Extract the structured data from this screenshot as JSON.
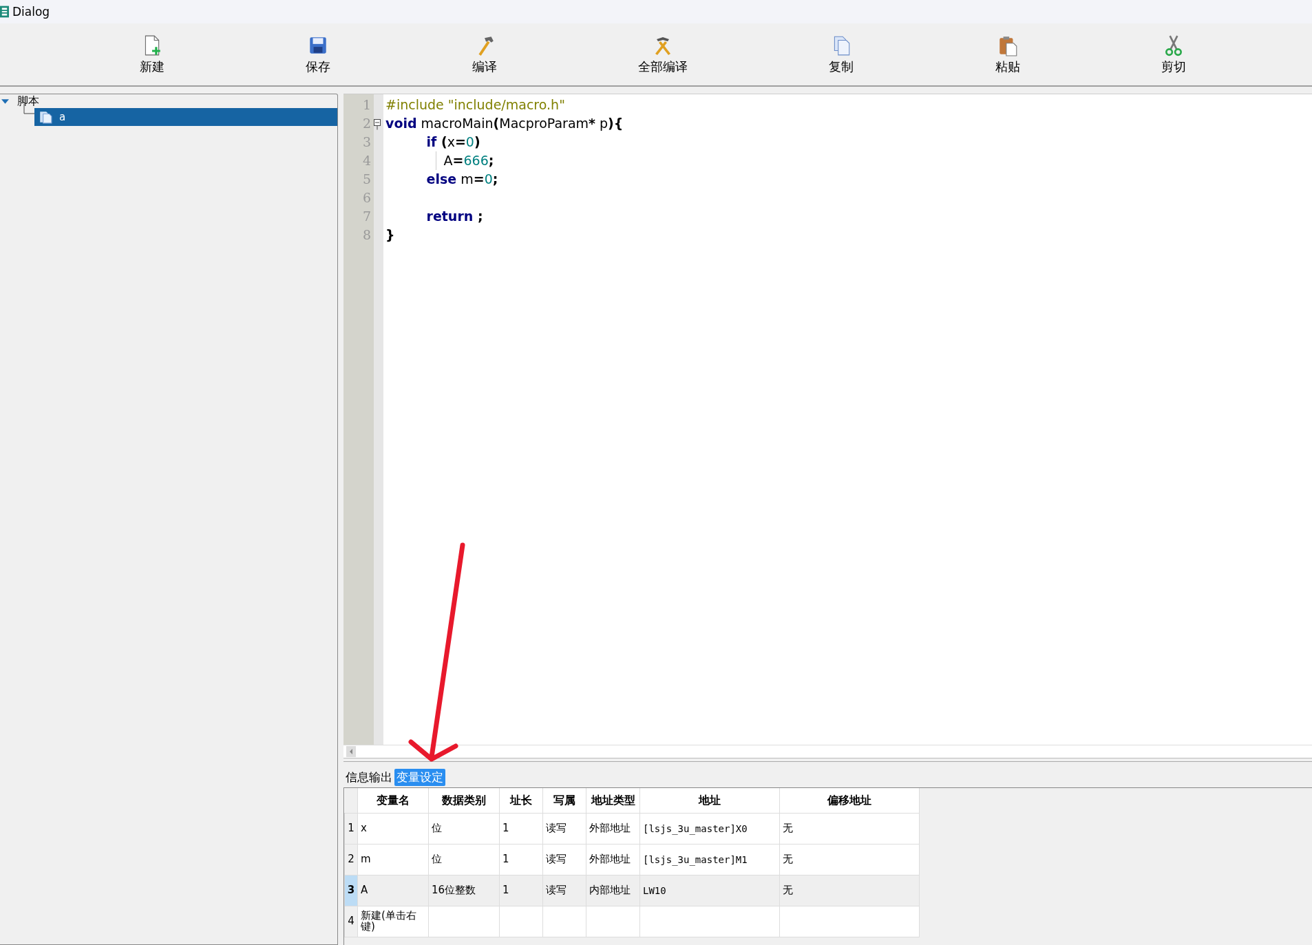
{
  "window": {
    "title": "Dialog"
  },
  "toolbar": [
    {
      "label": "新建"
    },
    {
      "label": "保存"
    },
    {
      "label": "编译"
    },
    {
      "label": "全部编译"
    },
    {
      "label": "复制"
    },
    {
      "label": "粘贴"
    },
    {
      "label": "剪切"
    }
  ],
  "tree": [
    {
      "label": "脚本",
      "expanded": true,
      "children": [
        {
          "label": "a",
          "selected": true
        }
      ]
    }
  ],
  "editor": {
    "lines": [
      {
        "number": "1",
        "tokens": [
          {
            "text": "#include \"include/macro.h\"",
            "kind": "preproc"
          }
        ]
      },
      {
        "number": "2",
        "fold": true,
        "tokens": [
          {
            "text": "void",
            "kind": "keyword"
          },
          {
            "text": " macroMain",
            "kind": "plain"
          },
          {
            "text": "(",
            "kind": "op"
          },
          {
            "text": "MacproParam",
            "kind": "plain"
          },
          {
            "text": "*",
            "kind": "op"
          },
          {
            "text": " p",
            "kind": "plain"
          },
          {
            "text": "){",
            "kind": "op"
          }
        ]
      },
      {
        "number": "3",
        "tokens": [
          {
            "text": "         if",
            "kind": "keyword"
          },
          {
            "text": " (",
            "kind": "op"
          },
          {
            "text": "x",
            "kind": "plain"
          },
          {
            "text": "=",
            "kind": "op"
          },
          {
            "text": "0",
            "kind": "number"
          },
          {
            "text": ")",
            "kind": "op"
          }
        ]
      },
      {
        "number": "4",
        "guide": true,
        "tokens": [
          {
            "text": "              A",
            "kind": "plain"
          },
          {
            "text": "=",
            "kind": "op"
          },
          {
            "text": "666",
            "kind": "number"
          },
          {
            "text": ";",
            "kind": "op"
          }
        ]
      },
      {
        "number": "5",
        "tokens": [
          {
            "text": "         else",
            "kind": "keyword"
          },
          {
            "text": " m",
            "kind": "plain"
          },
          {
            "text": "=",
            "kind": "op"
          },
          {
            "text": "0",
            "kind": "number"
          },
          {
            "text": ";",
            "kind": "op"
          }
        ]
      },
      {
        "number": "6"
      },
      {
        "number": "7",
        "tokens": [
          {
            "text": "         return",
            "kind": "keyword"
          },
          {
            "text": " ;",
            "kind": "op"
          }
        ]
      },
      {
        "number": "8",
        "tokens": [
          {
            "text": "}",
            "kind": "op"
          }
        ]
      }
    ]
  },
  "bottom_tabs": [
    {
      "label": "信息输出",
      "selected": false
    },
    {
      "label": "变量设定",
      "selected": true
    }
  ],
  "variables_table": {
    "columns": [
      "变量名",
      "数据类别",
      "址长",
      "写属",
      "地址类型",
      "地址",
      "偏移地址"
    ],
    "rows": [
      {
        "number": "1",
        "selected": false,
        "cells": [
          "x",
          "位",
          "1",
          "读写",
          "外部地址",
          "[lsjs_3u_master]X0",
          "无"
        ]
      },
      {
        "number": "2",
        "selected": false,
        "cells": [
          "m",
          "位",
          "1",
          "读写",
          "外部地址",
          "[lsjs_3u_master]M1",
          "无"
        ]
      },
      {
        "number": "3",
        "selected": true,
        "cells": [
          "A",
          "16位整数",
          "1",
          "读写",
          "内部地址",
          "LW10",
          "无"
        ]
      },
      {
        "number": "4",
        "selected": false,
        "cells": [
          "新建(单击右键)",
          "",
          "",
          "",
          "",
          "",
          ""
        ]
      }
    ]
  }
}
